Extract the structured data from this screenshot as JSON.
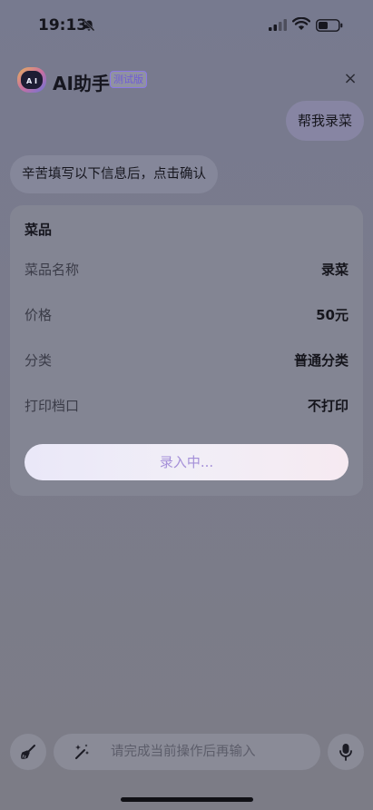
{
  "status": {
    "time": "19:13",
    "icons": [
      "bell-slash-icon",
      "signal-icon",
      "wifi-icon",
      "battery-icon"
    ]
  },
  "header": {
    "title": "AI助手",
    "badge": "测试版",
    "logo_icon": "robot-face-icon",
    "close_label": "×"
  },
  "chat": {
    "user_message": "帮我录菜",
    "ai_message": "辛苦填写以下信息后，点击确认"
  },
  "form": {
    "title": "菜品",
    "rows": [
      {
        "label": "菜品名称",
        "value": "录菜"
      },
      {
        "label": "价格",
        "value": "50元"
      },
      {
        "label": "分类",
        "value": "普通分类"
      },
      {
        "label": "打印档口",
        "value": "不打印"
      }
    ],
    "submit_label": "录入中..."
  },
  "input_bar": {
    "placeholder": "请完成当前操作后再输入",
    "left_icon": "broom-icon",
    "inner_icon": "sparkle-wand-icon",
    "right_icon": "microphone-icon"
  },
  "colors": {
    "accent": "#7b66dd",
    "overlay": "#787a8c"
  }
}
